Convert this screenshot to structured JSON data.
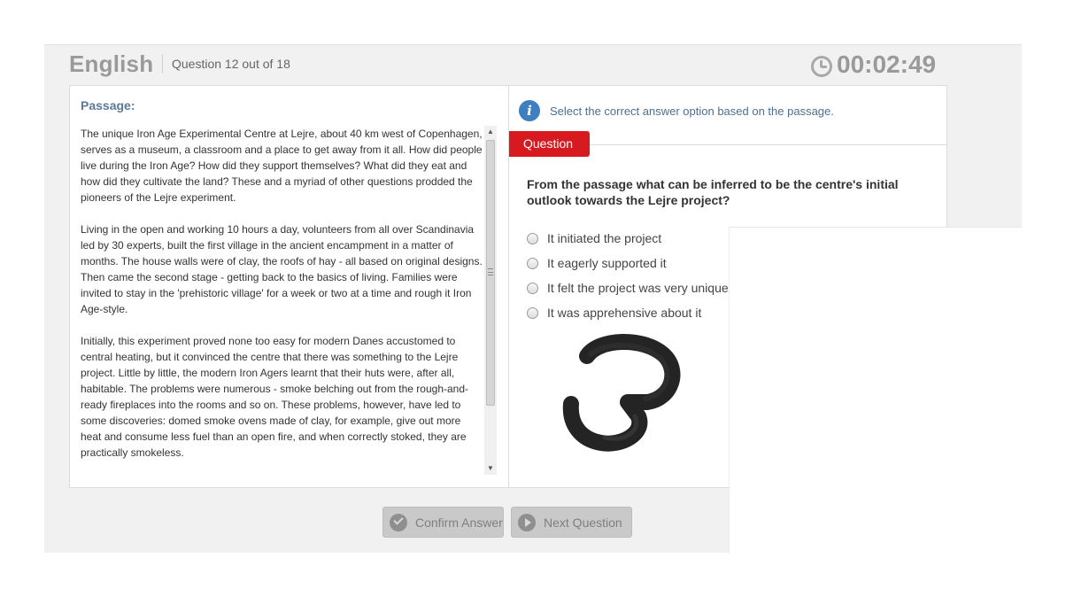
{
  "header": {
    "subject": "English",
    "question_counter": "Question 12 out of 18",
    "timer": "00:02:49"
  },
  "passage": {
    "heading": "Passage:",
    "paragraphs": [
      "The unique Iron Age Experimental Centre at Lejre, about 40 km west of Copenhagen, serves as a museum, a classroom and a place to get away from it all. How did people live during the Iron Age? How did they support themselves? What did they eat and how did they cultivate the land? These and a myriad of other questions prodded the pioneers of the Lejre experiment.",
      "Living in the open and working 10 hours a day, volunteers from all over Scandinavia led by 30 experts, built the first village in the ancient encampment in a matter of months. The house walls were of clay, the roofs of hay - all based on original designs. Then came the second stage - getting back to the basics of living. Families were invited to stay in the 'prehistoric village' for a week or two at a time and rough it Iron Age-style.",
      "Initially, this experiment proved none too easy for modern Danes accustomed to central heating, but it convinced the centre that there was something to the Lejre project. Little by little, the modern Iron Agers learnt that their huts were, after all, habitable. The problems were numerous - smoke belching out from the rough-and-ready fireplaces into the rooms and so on. These problems, however, have led to some discoveries: domed smoke ovens made of clay, for example, give out more heat and consume less fuel than an open fire, and when correctly stoked, they are practically smokeless."
    ]
  },
  "question": {
    "instruction": "Select the correct answer option based on the passage.",
    "tab_label": "Question",
    "text": "From the passage what can be inferred to be the centre's initial outlook towards the Lejre project?",
    "options": [
      "It initiated the project",
      "It eagerly supported it",
      "It felt the project was very unique",
      "It was apprehensive about it"
    ]
  },
  "buttons": {
    "confirm": "Confirm Answer",
    "next": "Next Question"
  },
  "colors": {
    "accent_red": "#d71920",
    "info_blue": "#3d7fc1",
    "heading_blue": "#5b7a99"
  },
  "icons": {
    "timer": "clock-icon",
    "instruction": "info-icon",
    "confirm": "check-circle-icon",
    "next": "play-circle-icon"
  }
}
